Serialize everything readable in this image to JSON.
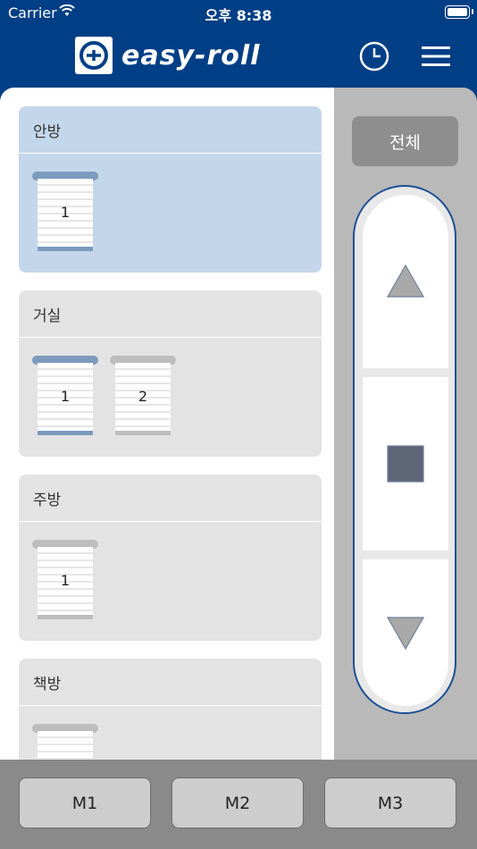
{
  "status_bar": {
    "carrier": "Carrier",
    "time": "오후 8:38"
  },
  "header": {
    "logo_text": "easy-roll",
    "icons": [
      "clock-icon",
      "hamburger-menu-icon"
    ]
  },
  "rooms": [
    {
      "name": "안방",
      "active": true,
      "blinds": [
        {
          "label": "1",
          "selected": true
        }
      ]
    },
    {
      "name": "거실",
      "active": false,
      "blinds": [
        {
          "label": "1",
          "selected": true
        },
        {
          "label": "2",
          "selected": false
        }
      ]
    },
    {
      "name": "주방",
      "active": false,
      "blinds": [
        {
          "label": "1",
          "selected": false
        }
      ]
    },
    {
      "name": "책방",
      "active": false,
      "blinds": [
        {
          "label": "",
          "selected": false
        }
      ]
    }
  ],
  "controls": {
    "all_label": "전체",
    "icons": [
      "up-triangle-icon",
      "stop-square-icon",
      "down-triangle-icon"
    ]
  },
  "memory_buttons": [
    "M1",
    "M2",
    "M3"
  ],
  "colors": {
    "brand_blue": "#003f86",
    "active_room": "#c4d7ea",
    "selected_blind": "#7b9bbd",
    "stop_square": "#5e6577"
  }
}
